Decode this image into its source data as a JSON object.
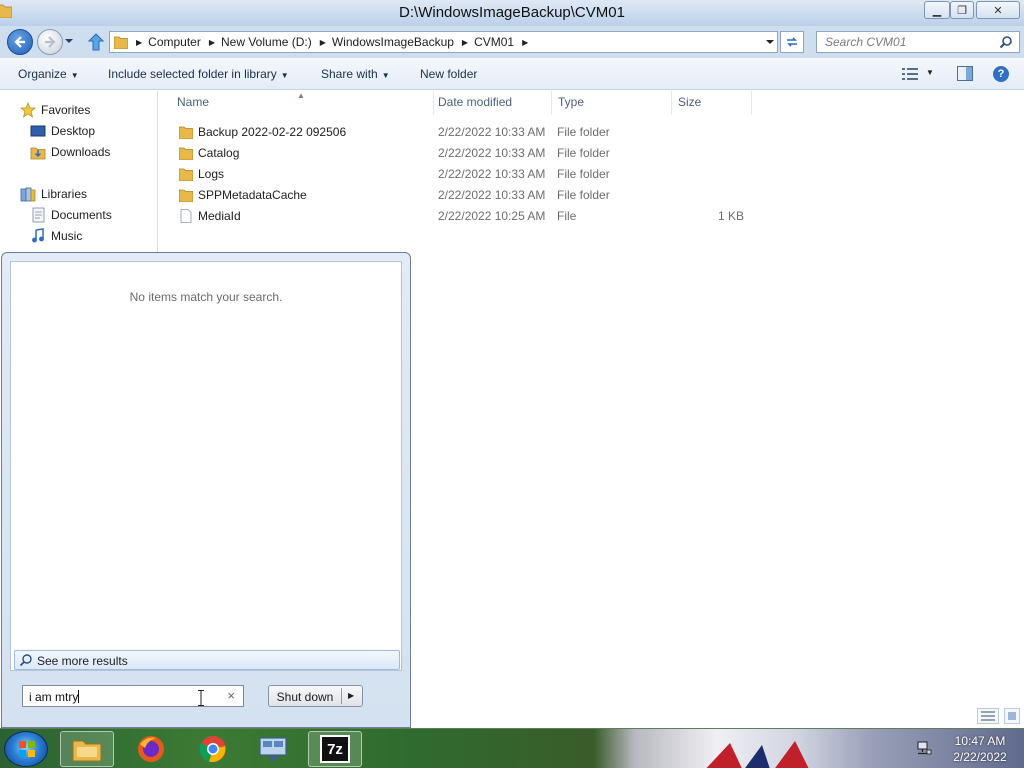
{
  "window": {
    "title": "D:\\WindowsImageBackup\\CVM01",
    "min_glyph": "▁",
    "max_glyph": "❐",
    "close_glyph": "✕"
  },
  "address": {
    "crumbs": [
      "Computer",
      "New Volume (D:)",
      "WindowsImageBackup",
      "CVM01"
    ],
    "search_placeholder": "Search CVM01"
  },
  "toolbar": {
    "organize": "Organize",
    "include": "Include selected folder in library",
    "share": "Share with",
    "new_folder": "New folder",
    "help": "?"
  },
  "nav": {
    "favorites": "Favorites",
    "desktop": "Desktop",
    "downloads": "Downloads",
    "libraries": "Libraries",
    "documents": "Documents",
    "music": "Music"
  },
  "columns": {
    "name": "Name",
    "date": "Date modified",
    "type": "Type",
    "size": "Size"
  },
  "files": [
    {
      "name": "Backup 2022-02-22 092506",
      "date": "2/22/2022 10:33 AM",
      "type": "File folder",
      "size": "",
      "icon": "folder-icon"
    },
    {
      "name": "Catalog",
      "date": "2/22/2022 10:33 AM",
      "type": "File folder",
      "size": "",
      "icon": "folder-icon"
    },
    {
      "name": "Logs",
      "date": "2/22/2022 10:33 AM",
      "type": "File folder",
      "size": "",
      "icon": "folder-icon"
    },
    {
      "name": "SPPMetadataCache",
      "date": "2/22/2022 10:33 AM",
      "type": "File folder",
      "size": "",
      "icon": "folder-icon"
    },
    {
      "name": "MediaId",
      "date": "2/22/2022 10:25 AM",
      "type": "File",
      "size": "1 KB",
      "icon": "file-icon"
    }
  ],
  "start_menu": {
    "empty_message": "No items match your search.",
    "see_more": "See more results",
    "search_value": "i am mtry",
    "clear_glyph": "×",
    "shutdown": "Shut down"
  },
  "taskbar": {
    "seven_zip": "7z",
    "time": "10:47 AM",
    "date": "2/22/2022"
  },
  "colors": {
    "accent": "#2d6bc4",
    "titlebar": "#c9daee",
    "folder": "#e8b84a"
  }
}
